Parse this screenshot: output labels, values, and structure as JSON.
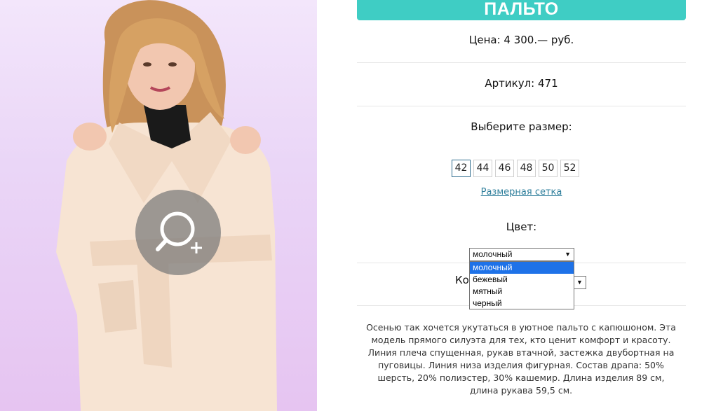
{
  "product": {
    "title": "ПАЛЬТО",
    "price": "Цена: 4 300.— руб.",
    "article": "Артикул: 471",
    "size_prompt": "Выберите размер:",
    "sizes": [
      "42",
      "44",
      "46",
      "48",
      "50",
      "52"
    ],
    "selected_size": "42",
    "size_chart_link": "Размерная сетка",
    "color_label": "Цвет:",
    "color_select": {
      "value": "молочный",
      "options": [
        "молочный",
        "бежевый",
        "мятный",
        "черный"
      ]
    },
    "quantity_label_visible": "Ко",
    "description": "Осенью так хочется укутаться в уютное пальто с капюшоном. Эта модель прямого силуэта для тех, кто ценит комфорт и красоту. Линия плеча спущенная, рукав втачной, застежка двубортная на пуговицы. Линия низа изделия фигурная. Состав драпа: 50% шерсть, 20% полиэстер, 30% кашемир. Длина изделия 89 см, длина рукава 59,5 см."
  },
  "icons": {
    "zoom": "zoom-in-icon",
    "dropdown_arrow": "▼"
  },
  "colors": {
    "title_bar": "#3fcdc4",
    "link": "#2f7f9c",
    "active_size_border": "#2f6d8f",
    "selected_option": "#1e72e8"
  }
}
